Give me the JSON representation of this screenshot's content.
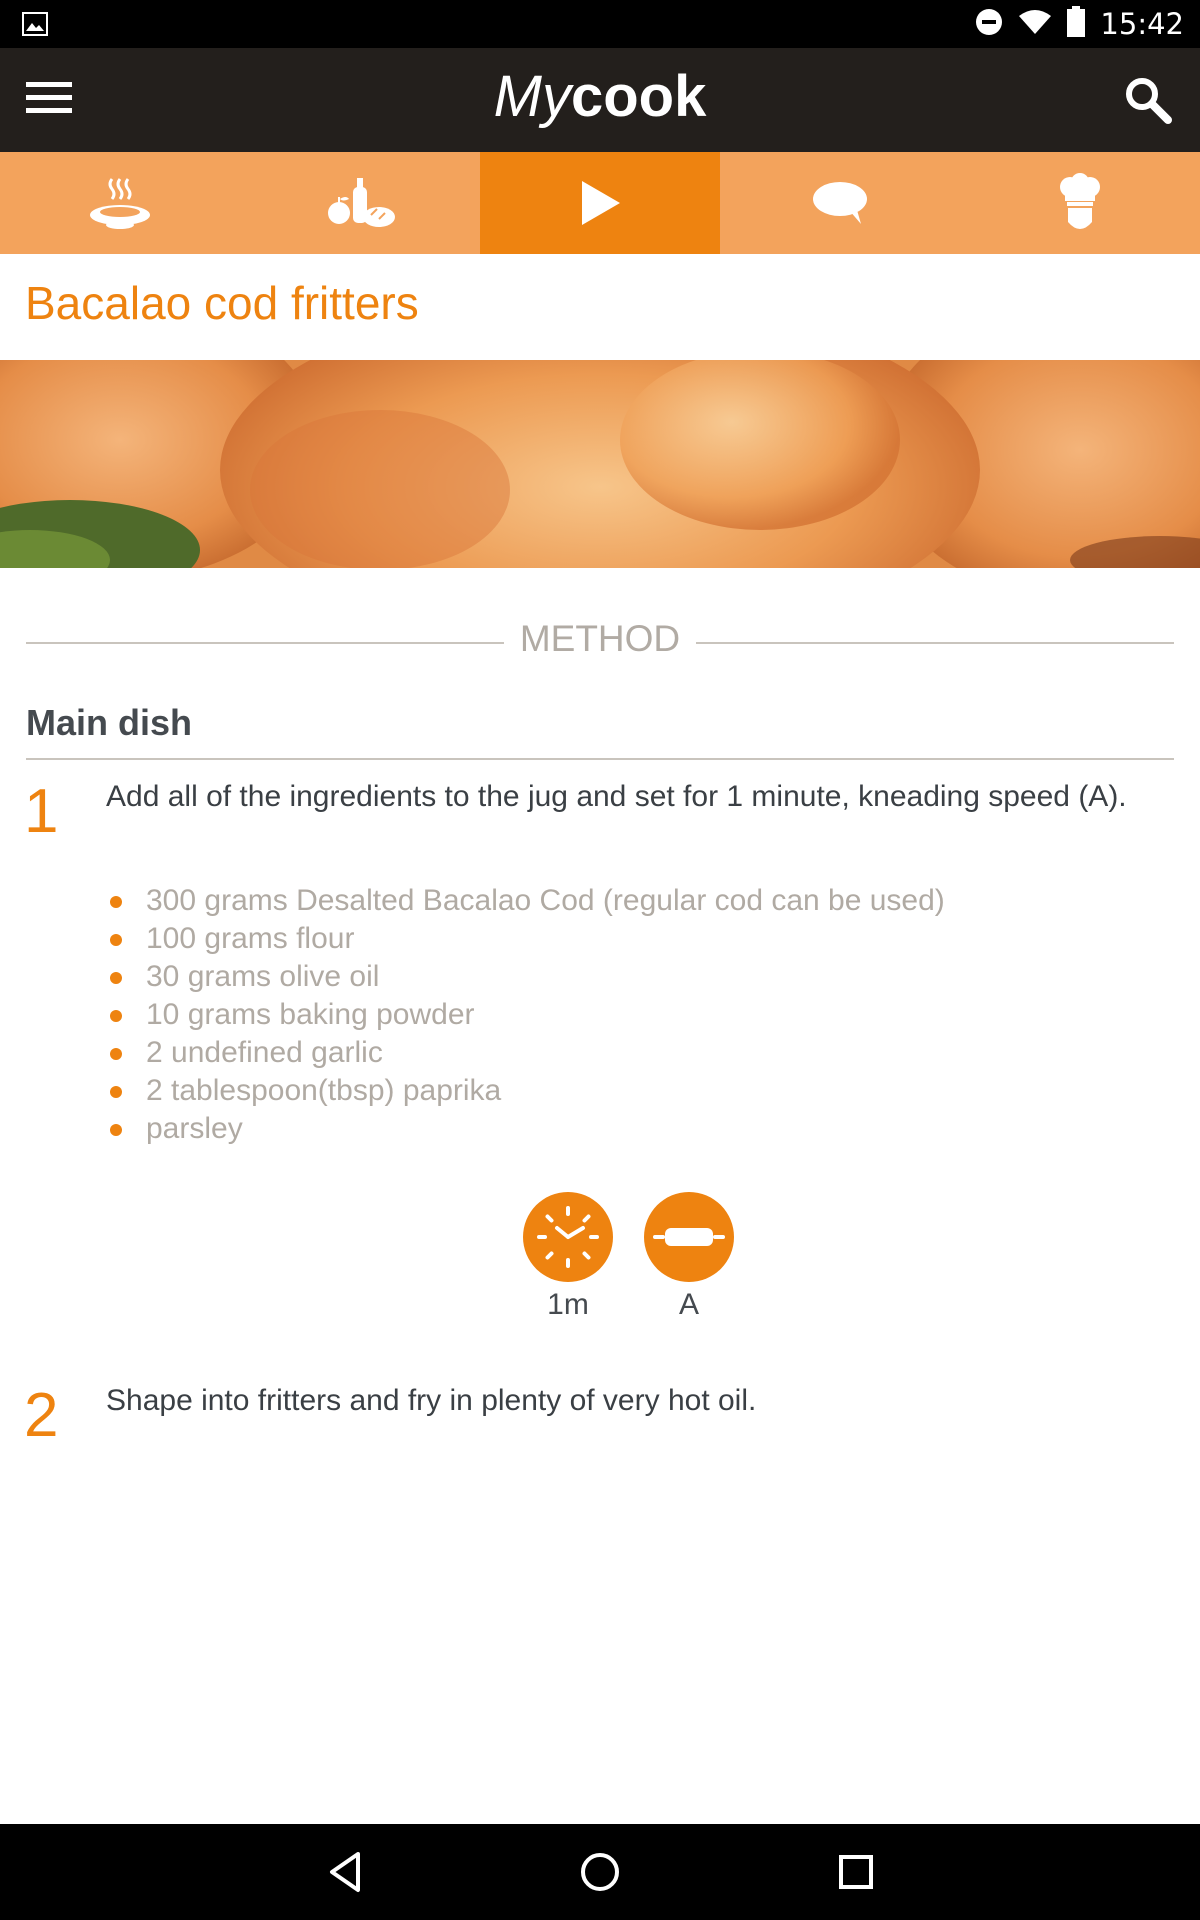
{
  "status_bar": {
    "time": "15:42"
  },
  "app_bar": {
    "logo_my": "My",
    "logo_cook": "cook"
  },
  "tabs": [
    {
      "name": "tab-dish",
      "icon": "soup-bowl-icon",
      "active": false
    },
    {
      "name": "tab-ingredients",
      "icon": "groceries-icon",
      "active": false
    },
    {
      "name": "tab-method",
      "icon": "play-icon",
      "active": true
    },
    {
      "name": "tab-comments",
      "icon": "speech-bubble-icon",
      "active": false
    },
    {
      "name": "tab-chef",
      "icon": "chef-hat-icon",
      "active": false
    }
  ],
  "recipe": {
    "title": "Bacalao cod fritters"
  },
  "method": {
    "label": "METHOD",
    "section_title": "Main dish",
    "steps": [
      {
        "number": "1",
        "text": "Add all of the ingredients to the jug and set for 1 minute, kneading speed (A).",
        "ingredients": [
          "300 grams Desalted Bacalao Cod (regular cod can be used)",
          "100 grams flour",
          "30 grams olive oil",
          "10 grams baking powder",
          "2 undefined garlic",
          "2 tablespoon(tbsp) paprika",
          "parsley"
        ],
        "params": [
          {
            "icon": "clock-icon",
            "label": "1m"
          },
          {
            "icon": "kneading-icon",
            "label": "A"
          }
        ]
      },
      {
        "number": "2",
        "text": "Shape into fritters and fry in plenty of very hot oil."
      }
    ]
  },
  "colors": {
    "accent": "#ee8310",
    "tab_bar": "#f3a35c",
    "app_bar": "#231f1c",
    "ingredient_text": "#b0aaa3",
    "body_text": "#3a3f44"
  }
}
